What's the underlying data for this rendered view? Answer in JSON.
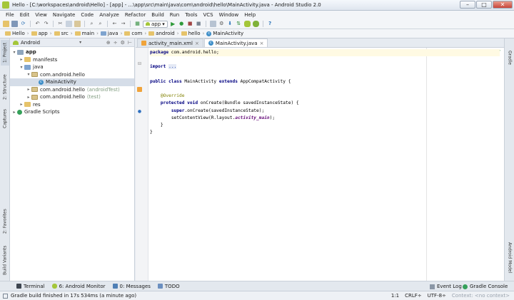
{
  "window": {
    "title": "Hello - [C:\\workspaces\\android\\Hello] - [app] - ...\\app\\src\\main\\java\\com\\android\\hello\\MainActivity.java - Android Studio 2.0",
    "minimize": "–",
    "maximize": "□",
    "close": "✕"
  },
  "menu": [
    "File",
    "Edit",
    "View",
    "Navigate",
    "Code",
    "Analyze",
    "Refactor",
    "Build",
    "Run",
    "Tools",
    "VCS",
    "Window",
    "Help"
  ],
  "toolbar": {
    "run_config": "app"
  },
  "breadcrumbs": [
    "Hello",
    "app",
    "src",
    "main",
    "java",
    "com",
    "android",
    "hello",
    "MainActivity"
  ],
  "left_strip": {
    "project": "1: Project",
    "structure": "2: Structure",
    "captures": "Captures",
    "favorites": "2: Favorites",
    "build_variants": "Build Variants"
  },
  "right_strip": {
    "gradle": "Gradle",
    "android_model": "Android Model"
  },
  "project_panel": {
    "view_mode": "Android",
    "dropdown": "▾",
    "tools": [
      "⊕",
      "÷",
      "⚙",
      "⊢"
    ],
    "tree": [
      {
        "label": "app",
        "arrow": "▾",
        "icon": "app",
        "indent": 0
      },
      {
        "label": "manifests",
        "arrow": "▸",
        "icon": "folder",
        "indent": 1
      },
      {
        "label": "java",
        "arrow": "▾",
        "icon": "blue",
        "indent": 1
      },
      {
        "label": "com.android.hello",
        "arrow": "▾",
        "icon": "pkg",
        "indent": 2
      },
      {
        "label": "MainActivity",
        "arrow": "",
        "icon": "class",
        "indent": 3,
        "selected": true
      },
      {
        "label": "com.android.hello",
        "suffix": "(androidTest)",
        "arrow": "▸",
        "icon": "pkg",
        "indent": 2
      },
      {
        "label": "com.android.hello",
        "suffix": "(test)",
        "arrow": "▸",
        "icon": "pkg",
        "indent": 2
      },
      {
        "label": "res",
        "arrow": "▸",
        "icon": "folder",
        "indent": 1
      },
      {
        "label": "Gradle Scripts",
        "arrow": "▸",
        "icon": "gradle",
        "indent": 0
      }
    ]
  },
  "editor": {
    "tabs": [
      {
        "label": "activity_main.xml",
        "type": "xml",
        "active": false,
        "close": "×"
      },
      {
        "label": "MainActivity.java",
        "type": "class",
        "active": true,
        "close": "×"
      }
    ],
    "code": {
      "l1_kw": "package",
      "l1_rest": " com.android.hello;",
      "l3_kw": "import",
      "l3_fold": "...",
      "l5_kw": "public class",
      "l5_name": " MainActivity ",
      "l5_kw2": "extends",
      "l5_rest": " AppCompatActivity {",
      "l7_ann": "@Override",
      "l8_kw": "protected void",
      "l8_rest": " onCreate(Bundle savedInstanceState) {",
      "l9_kw": "super",
      "l9_rest": ".onCreate(savedInstanceState);",
      "l10_a": "setContentView(R.layout.",
      "l10_fld": "activity_main",
      "l10_b": ");",
      "l11": "}",
      "l12": "}"
    }
  },
  "bottom_tools": {
    "terminal": "Terminal",
    "android_monitor": "6: Android Monitor",
    "messages": "0: Messages",
    "todo": "TODO",
    "event_log": "Event Log",
    "gradle_console": "Gradle Console"
  },
  "status": {
    "message": "Gradle build finished in 17s 534ms (a minute ago)",
    "position": "1:1",
    "line_sep": "CRLF÷",
    "encoding": "UTF-8÷",
    "context": "Context: <no context>"
  }
}
